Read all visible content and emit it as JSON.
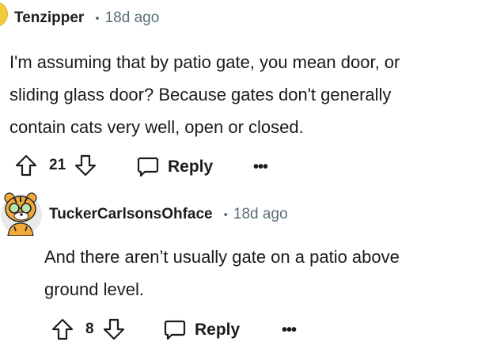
{
  "comments": [
    {
      "username": "Tenzipper",
      "separator": "•",
      "time": "18d ago",
      "lines": [
        "I'm assuming that by patio gate, you mean door, or",
        "sliding glass door? Because gates don't generally",
        "contain cats very well, open or closed."
      ],
      "vote_count": "21",
      "reply_label": "Reply",
      "more_label": "•••"
    },
    {
      "username": "TuckerCarlsonsOhface",
      "separator": "•",
      "time": "18d ago",
      "lines": [
        "And there aren’t usually gate on a patio above",
        "ground level."
      ],
      "vote_count": "8",
      "reply_label": "Reply",
      "more_label": "•••"
    }
  ],
  "icons": {
    "upvote": "upvote-arrow-icon",
    "downvote": "downvote-arrow-icon",
    "reply": "speech-bubble-icon",
    "more": "ellipsis-icon"
  },
  "colors": {
    "text": "#1a1a1b",
    "meta": "#576f76",
    "avatar_yellow": "#f2cd3b"
  }
}
